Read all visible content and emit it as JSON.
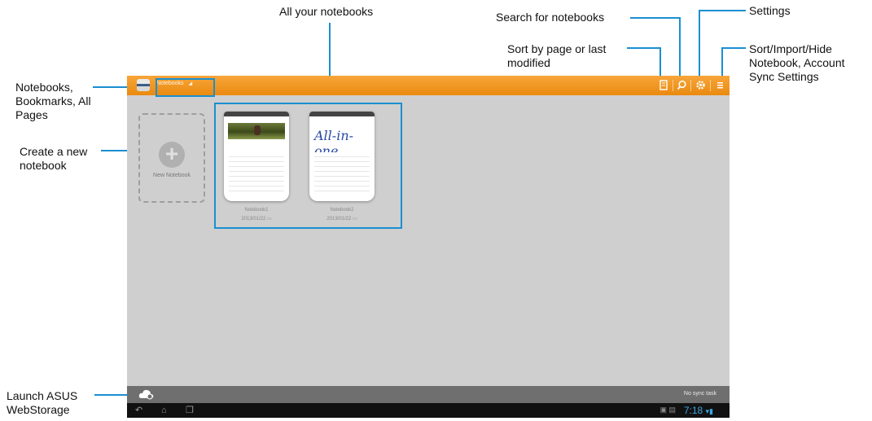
{
  "callouts": {
    "all_notebooks": "All your notebooks",
    "search": "Search for notebooks",
    "settings": "Settings",
    "sort": [
      "Sort by page or last",
      "modified"
    ],
    "sort_import": [
      "Sort/Import/Hide",
      "Notebook, Account",
      "Sync Settings"
    ],
    "notebooks_menu": [
      "Notebooks,",
      "Bookmarks, All",
      "Pages"
    ],
    "create_new": [
      "Create a new",
      "notebook"
    ],
    "webstorage": [
      "Launch ASUS",
      "WebStorage"
    ]
  },
  "topbar": {
    "dropdown_label": "Notebooks",
    "icons": [
      "sort-page-icon",
      "search-icon",
      "gear-icon",
      "overflow-menu-icon"
    ]
  },
  "new_notebook": {
    "label": "New Notebook"
  },
  "notebooks": [
    {
      "name": "Notebook1",
      "date": "2013/01/22",
      "cover": "photo"
    },
    {
      "name": "Notebook2",
      "date": "2013/01/22",
      "cover": "All-in-one"
    }
  ],
  "bottombar": {
    "sync_status": "No sync task"
  },
  "navbar": {
    "clock": "7:18"
  },
  "colors": {
    "accent_orange": "#ea8a10",
    "callout_blue": "#1a8fd0",
    "canvas_gray": "#cfcfcf"
  }
}
